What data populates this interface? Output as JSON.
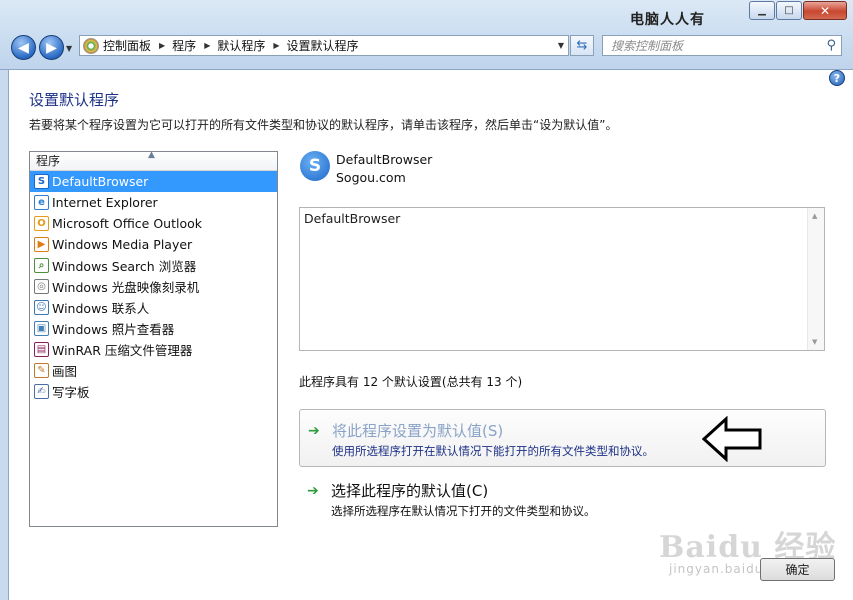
{
  "window": {
    "watermark_top": "电脑人人有",
    "controls": {
      "minimize": "▁",
      "maximize": "□",
      "close": "✕"
    }
  },
  "nav": {
    "back_glyph": "◀",
    "forward_glyph": "▶",
    "breadcrumbs": [
      "控制面板",
      "程序",
      "默认程序",
      "设置默认程序"
    ],
    "search_placeholder": "搜索控制面板"
  },
  "page": {
    "title": "设置默认程序",
    "description": "若要将某个程序设置为它可以打开的所有文件类型和协议的默认程序，请单击该程序，然后单击“设为默认值”。"
  },
  "program_list": {
    "header": "程序",
    "items": [
      {
        "label": "DefaultBrowser",
        "icon": "sogou-icon",
        "glyph": "S",
        "color": "#1d67c9",
        "selected": true
      },
      {
        "label": "Internet Explorer",
        "icon": "ie-icon",
        "glyph": "e",
        "color": "#2a7fd4",
        "selected": false
      },
      {
        "label": "Microsoft Office Outlook",
        "icon": "outlook-icon",
        "glyph": "O",
        "color": "#e49a1a",
        "selected": false
      },
      {
        "label": "Windows Media Player",
        "icon": "media-player-icon",
        "glyph": "▶",
        "color": "#e07b12",
        "selected": false
      },
      {
        "label": "Windows Search 浏览器",
        "icon": "search-browser-icon",
        "glyph": "⌕",
        "color": "#4d8e3a",
        "selected": false
      },
      {
        "label": "Windows 光盘映像刻录机",
        "icon": "disc-burner-icon",
        "glyph": "◎",
        "color": "#777777",
        "selected": false
      },
      {
        "label": "Windows 联系人",
        "icon": "contacts-icon",
        "glyph": "☺",
        "color": "#3a78b5",
        "selected": false
      },
      {
        "label": "Windows 照片查看器",
        "icon": "photo-viewer-icon",
        "glyph": "▣",
        "color": "#3f7fb8",
        "selected": false
      },
      {
        "label": "WinRAR 压缩文件管理器",
        "icon": "winrar-icon",
        "glyph": "▤",
        "color": "#8b1e5a",
        "selected": false
      },
      {
        "label": "画图",
        "icon": "paint-icon",
        "glyph": "✎",
        "color": "#c07a2a",
        "selected": false
      },
      {
        "label": "写字板",
        "icon": "wordpad-icon",
        "glyph": "✍",
        "color": "#4a6fa5",
        "selected": false
      }
    ]
  },
  "selected_program": {
    "name": "DefaultBrowser",
    "publisher": "Sogou.com",
    "description": "DefaultBrowser",
    "defaults_summary": "此程序具有 12 个默认设置(总共有 13 个)"
  },
  "actions": {
    "set_default": {
      "title": "将此程序设置为默认值(S)",
      "subtitle": "使用所选程序打开在默认情况下能打开的所有文件类型和协议。"
    },
    "choose_defaults": {
      "title": "选择此程序的默认值(C)",
      "subtitle": "选择所选程序在默认情况下打开的文件类型和协议。"
    }
  },
  "ok_button": "确定",
  "watermark": {
    "logo": "Baidu 经验",
    "url": "jingyan.baidu.com"
  },
  "colors": {
    "title_blue": "#1e3287",
    "selection": "#3399ff",
    "green_arrow": "#2e9b3a"
  }
}
